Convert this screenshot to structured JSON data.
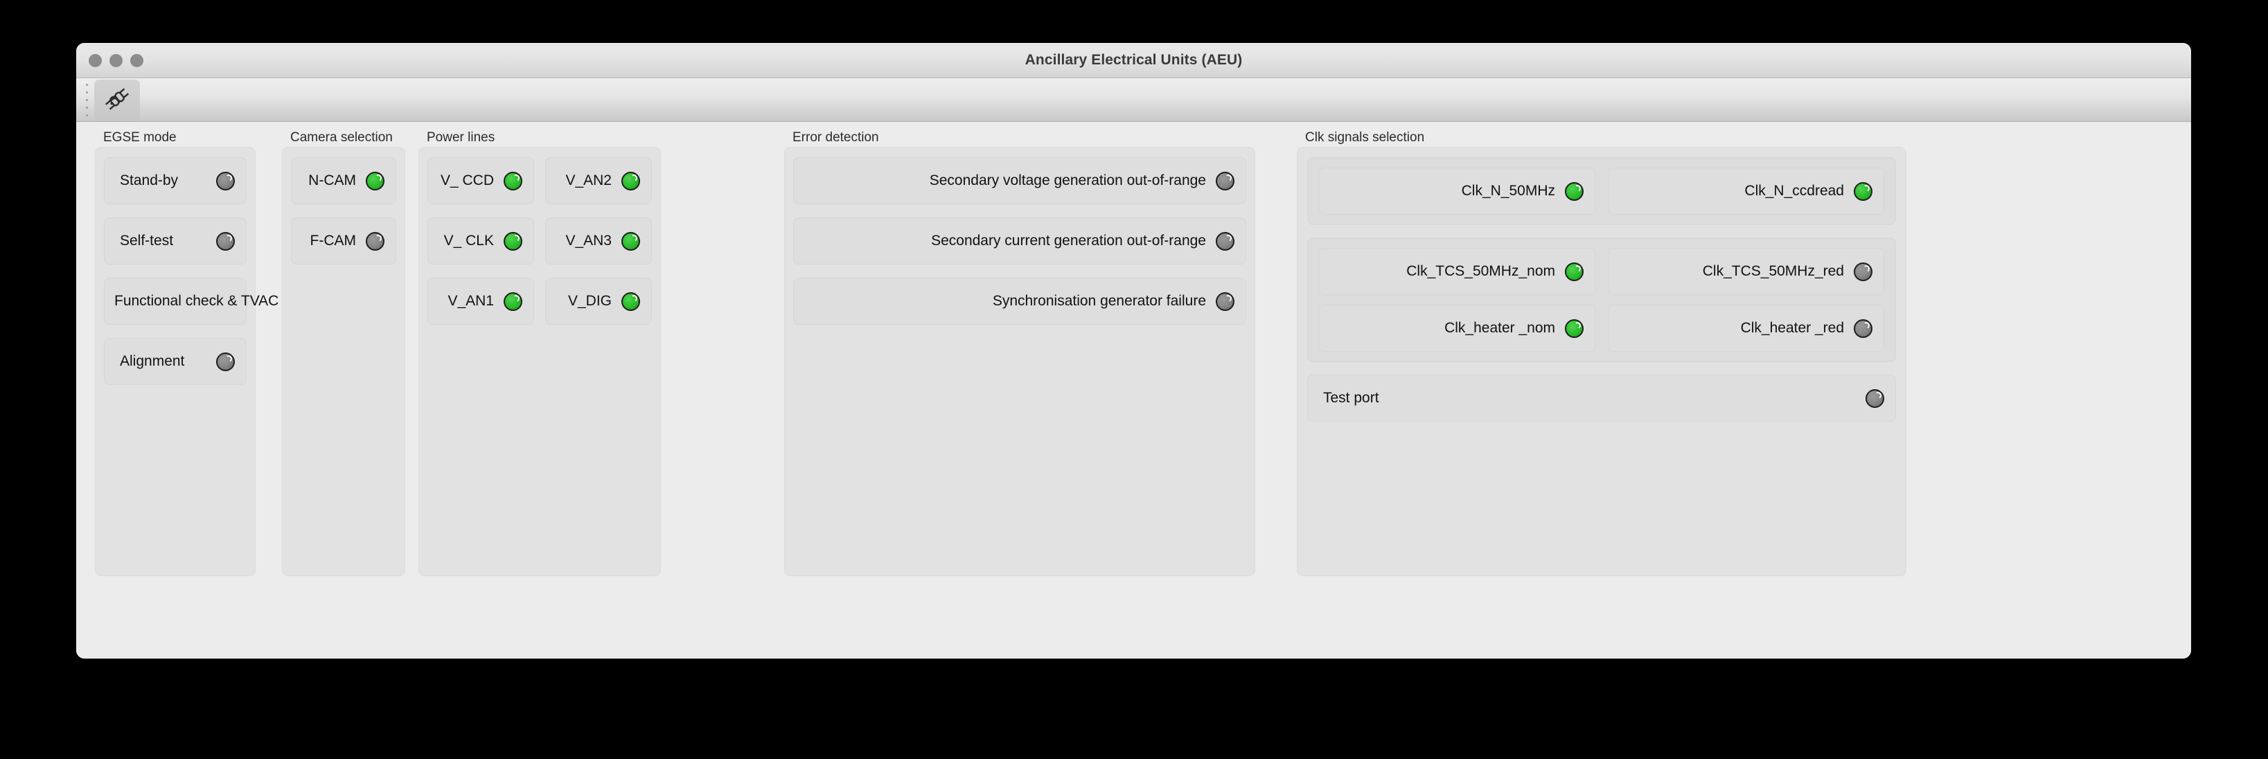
{
  "window": {
    "title": "Ancillary Electrical Units (AEU)",
    "traffic_lights": [
      "close-button",
      "minimize-button",
      "zoom-button"
    ]
  },
  "toolbar": {
    "drag_handle": "toolbar-drag-handle",
    "tabs": [
      {
        "icon": "plug-connector-icon",
        "selected": true
      }
    ]
  },
  "colors": {
    "led_on": "#2fc02f",
    "led_off": "#8a8a8a",
    "window_bg": "#ececec",
    "group_bg": "#e2e2e2",
    "row_bg": "#dedede"
  },
  "panels": {
    "egse_mode": {
      "title": "EGSE mode",
      "items": [
        {
          "label": "Stand-by",
          "state": "off"
        },
        {
          "label": "Self-test",
          "state": "off"
        },
        {
          "label": "Functional check & TVAC",
          "state": "on"
        },
        {
          "label": "Alignment",
          "state": "off"
        }
      ]
    },
    "camera_selection": {
      "title": "Camera selection",
      "items": [
        {
          "label": "N-CAM",
          "state": "on"
        },
        {
          "label": "F-CAM",
          "state": "off"
        }
      ]
    },
    "power_lines": {
      "title": "Power lines",
      "items": [
        {
          "label": "V_ CCD",
          "state": "on"
        },
        {
          "label": "V_AN2",
          "state": "on"
        },
        {
          "label": "V_ CLK",
          "state": "on"
        },
        {
          "label": "V_AN3",
          "state": "on"
        },
        {
          "label": "V_AN1",
          "state": "on"
        },
        {
          "label": "V_DIG",
          "state": "on"
        }
      ]
    },
    "error_detection": {
      "title": "Error detection",
      "items": [
        {
          "label": "Secondary voltage generation out-of-range",
          "state": "off"
        },
        {
          "label": "Secondary current generation out-of-range",
          "state": "off"
        },
        {
          "label": "Synchronisation generator failure",
          "state": "off"
        }
      ]
    },
    "clk_signals": {
      "title": "Clk signals selection",
      "group_a": [
        {
          "label": "Clk_N_50MHz",
          "state": "on"
        },
        {
          "label": "Clk_N_ccdread",
          "state": "on"
        }
      ],
      "group_b": [
        {
          "label": "Clk_TCS_50MHz_nom",
          "state": "on"
        },
        {
          "label": "Clk_TCS_50MHz_red",
          "state": "off"
        },
        {
          "label": "Clk_heater _nom",
          "state": "on"
        },
        {
          "label": "Clk_heater _red",
          "state": "off"
        }
      ],
      "test_port": {
        "label": "Test port",
        "state": "off"
      }
    }
  }
}
